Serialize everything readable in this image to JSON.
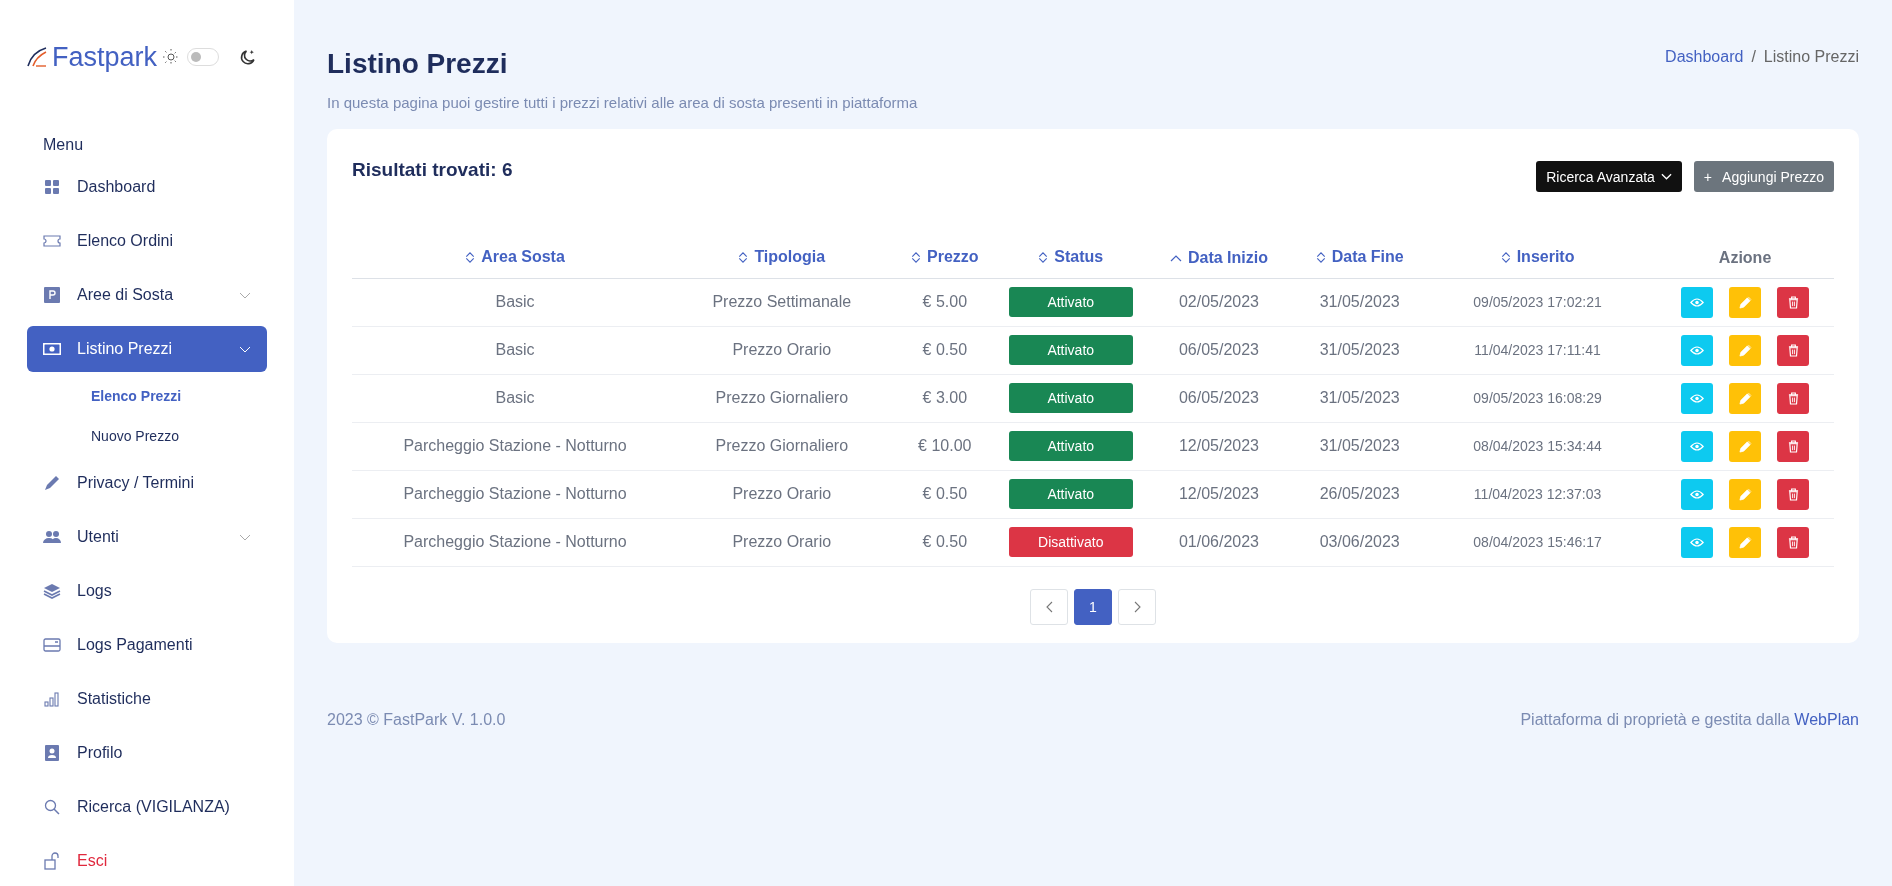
{
  "sidebar": {
    "logo": "Fastpark",
    "theme_toggle": {
      "on": false
    },
    "menu_heading": "Menu",
    "items": [
      {
        "label": "Dashboard",
        "kind": "link",
        "selected": false
      },
      {
        "label": "Elenco Ordini",
        "kind": "link",
        "selected": false
      },
      {
        "label": "Aree di Sosta",
        "kind": "group",
        "selected": false
      },
      {
        "label": "Listino Prezzi",
        "kind": "group",
        "selected": true,
        "children": [
          {
            "label": "Elenco Prezzi",
            "selected": true
          },
          {
            "label": "Nuovo Prezzo",
            "selected": false
          }
        ]
      },
      {
        "label": "Privacy / Termini",
        "kind": "link",
        "selected": false
      },
      {
        "label": "Utenti",
        "kind": "group",
        "selected": false
      },
      {
        "label": "Logs",
        "kind": "link",
        "selected": false
      },
      {
        "label": "Logs Pagamenti",
        "kind": "link",
        "selected": false
      },
      {
        "label": "Statistiche",
        "kind": "link",
        "selected": false
      },
      {
        "label": "Profilo",
        "kind": "link",
        "selected": false
      },
      {
        "label": "Ricerca (VIGILANZA)",
        "kind": "link",
        "selected": false
      },
      {
        "label": "Esci",
        "kind": "logout",
        "selected": false
      }
    ]
  },
  "page": {
    "title": "Listino Prezzi",
    "subtitle": "In questa pagina puoi gestire tutti i prezzi relativi alle area di sosta presenti in piattaforma",
    "breadcrumb_separator": "/",
    "breadcrumb": [
      {
        "label": "Dashboard",
        "kind": "link"
      },
      {
        "label": "Listino Prezzi",
        "kind": "current"
      }
    ]
  },
  "card": {
    "results": "Risultati trovati: 6",
    "buttons": [
      {
        "label": "Ricerca Avanzata",
        "kind": "dropdown"
      },
      {
        "label": "Aggiungi Prezzo",
        "kind": "add",
        "icon": "+"
      }
    ],
    "table": {
      "columns": [
        {
          "label": "Area Sosta",
          "sortable": true,
          "sorted": false
        },
        {
          "label": "Tipologia",
          "sortable": true,
          "sorted": false
        },
        {
          "label": "Prezzo",
          "sortable": true,
          "sorted": false
        },
        {
          "label": "Status",
          "sortable": true,
          "sorted": false
        },
        {
          "label": "Data Inizio",
          "sortable": true,
          "sorted": true
        },
        {
          "label": "Data Fine",
          "sortable": true,
          "sorted": false
        },
        {
          "label": "Inserito",
          "sortable": true,
          "sorted": false
        },
        {
          "label": "Azione",
          "sortable": false
        }
      ],
      "rows": [
        {
          "area": "Basic",
          "tipologia": "Prezzo Settimanale",
          "prezzo": "€ 5.00",
          "status": "Attivato",
          "active": true,
          "inizio": "02/05/2023",
          "fine": "31/05/2023",
          "inserito": "09/05/2023 17:02:21"
        },
        {
          "area": "Basic",
          "tipologia": "Prezzo Orario",
          "prezzo": "€ 0.50",
          "status": "Attivato",
          "active": true,
          "inizio": "06/05/2023",
          "fine": "31/05/2023",
          "inserito": "11/04/2023 17:11:41"
        },
        {
          "area": "Basic",
          "tipologia": "Prezzo Giornaliero",
          "prezzo": "€ 3.00",
          "status": "Attivato",
          "active": true,
          "inizio": "06/05/2023",
          "fine": "31/05/2023",
          "inserito": "09/05/2023 16:08:29"
        },
        {
          "area": "Parcheggio Stazione - Notturno",
          "tipologia": "Prezzo Giornaliero",
          "prezzo": "€ 10.00",
          "status": "Attivato",
          "active": true,
          "inizio": "12/05/2023",
          "fine": "31/05/2023",
          "inserito": "08/04/2023 15:34:44"
        },
        {
          "area": "Parcheggio Stazione - Notturno",
          "tipologia": "Prezzo Orario",
          "prezzo": "€ 0.50",
          "status": "Attivato",
          "active": true,
          "inizio": "12/05/2023",
          "fine": "26/05/2023",
          "inserito": "11/04/2023 12:37:03"
        },
        {
          "area": "Parcheggio Stazione - Notturno",
          "tipologia": "Prezzo Orario",
          "prezzo": "€ 0.50",
          "status": "Disattivato",
          "active": false,
          "inizio": "01/06/2023",
          "fine": "03/06/2023",
          "inserito": "08/04/2023 15:46:17"
        }
      ]
    },
    "pagination": [
      {
        "label": "1",
        "selected": true
      }
    ]
  },
  "footer": {
    "copyright": "2023 © FastPark V. 1.0.0",
    "credit": "Piattaforma di proprietà e gestita dalla",
    "credit_link": "WebPlan"
  }
}
